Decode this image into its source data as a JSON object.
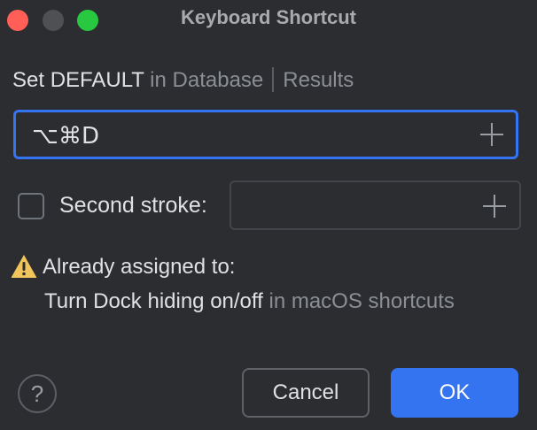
{
  "window": {
    "title": "Keyboard Shortcut"
  },
  "context": {
    "action": "Set DEFAULT",
    "in_word": "in Database",
    "group": "Results"
  },
  "first_stroke": {
    "value": "⌥⌘D",
    "add_icon": "plus-icon"
  },
  "second_stroke": {
    "label": "Second stroke:",
    "checked": false,
    "value": "",
    "add_icon": "plus-icon"
  },
  "conflict": {
    "icon": "warning-icon",
    "title": "Already assigned to:",
    "action_name": "Turn Dock hiding on/off",
    "location": "in macOS shortcuts"
  },
  "buttons": {
    "help": "?",
    "cancel": "Cancel",
    "ok": "OK"
  },
  "colors": {
    "background": "#2b2d30",
    "accent": "#3574f0",
    "warning": "#f2c55c",
    "close": "#ff5f57",
    "maximize": "#28c840"
  }
}
